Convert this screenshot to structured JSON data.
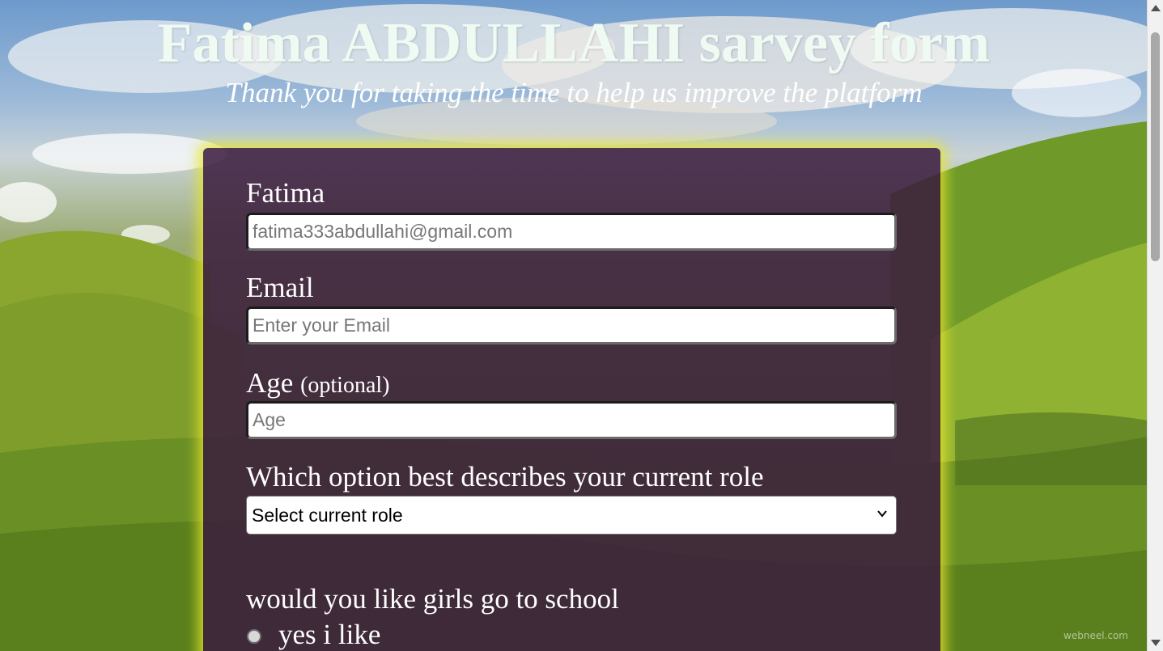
{
  "header": {
    "title": "Fatima ABDULLAHI sarvey form",
    "subtitle": "Thank you for taking the time to help us improve the platform"
  },
  "form": {
    "name": {
      "label": "Fatima",
      "value": "fatima333abdullahi@gmail.com"
    },
    "email": {
      "label": "Email",
      "placeholder": "Enter your Email"
    },
    "age": {
      "label": "Age",
      "label_optional": "(optional)",
      "placeholder": "Age"
    },
    "role": {
      "label": "Which option best describes your current role",
      "selected": "Select current role"
    },
    "school_question": {
      "label": "would you like girls go to school",
      "options": [
        {
          "label": "yes i like"
        }
      ]
    }
  },
  "background": {
    "watermark": "webneel.com"
  },
  "colors": {
    "card_background": "#3a1c3e",
    "card_glow": "#e6e628",
    "title_color": "#eefaf2"
  },
  "icons": {
    "select_arrow": "chevron-down-icon",
    "radio": "radio-button-icon"
  }
}
